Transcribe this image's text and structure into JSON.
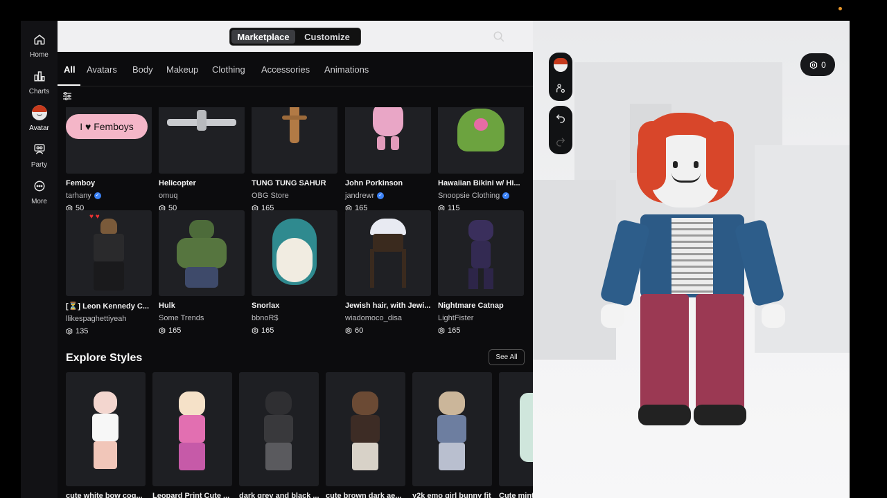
{
  "nav": {
    "items": [
      {
        "label": "Home",
        "icon": "home-icon"
      },
      {
        "label": "Charts",
        "icon": "charts-icon"
      },
      {
        "label": "Avatar",
        "icon": "avatar-icon"
      },
      {
        "label": "Party",
        "icon": "party-icon"
      },
      {
        "label": "More",
        "icon": "more-icon"
      }
    ]
  },
  "header": {
    "segment": {
      "marketplace": "Marketplace",
      "customize": "Customize",
      "active": "Marketplace"
    }
  },
  "tabs": [
    "All",
    "Avatars",
    "Body",
    "Makeup",
    "Clothing",
    "Accessories",
    "Animations"
  ],
  "active_tab": "All",
  "items_row1": [
    {
      "name": "Femboy",
      "creator": "tarhany",
      "verified": true,
      "price": "50",
      "badge_text": "I ♥ Femboys"
    },
    {
      "name": "Helicopter",
      "creator": "omuq",
      "verified": false,
      "price": "50"
    },
    {
      "name": "TUNG TUNG  SAHUR",
      "creator": "OBG Store",
      "verified": false,
      "price": "165"
    },
    {
      "name": "John Porkinson",
      "creator": "jandrewr",
      "verified": true,
      "price": "165"
    },
    {
      "name": "Hawaiian Bikini w/ Hi...",
      "creator": "Snoopsie Clothing",
      "verified": true,
      "price": "115"
    }
  ],
  "items_row2": [
    {
      "name": "[⏳] Leon Kennedy C...",
      "creator": "llikespaghettiyeah",
      "verified": false,
      "price": "135"
    },
    {
      "name": "Hulk",
      "creator": "Some Trends",
      "verified": false,
      "price": "165"
    },
    {
      "name": "Snorlax",
      "creator": "bbnoR$",
      "verified": false,
      "price": "165"
    },
    {
      "name": "Jewish hair, with Jewi...",
      "creator": "wiadomoco_disa",
      "verified": false,
      "price": "60"
    },
    {
      "name": "Nightmare Catnap",
      "creator": "LightFister",
      "verified": false,
      "price": "165"
    }
  ],
  "explore": {
    "title": "Explore Styles",
    "see_all": "See All",
    "styles": [
      {
        "name": "cute white bow cog..."
      },
      {
        "name": "Leopard Print Cute ..."
      },
      {
        "name": "dark grey and black ..."
      },
      {
        "name": "cute brown dark ae..."
      },
      {
        "name": "y2k emo girl bunny fit"
      },
      {
        "name": "Cute mint..."
      }
    ]
  },
  "viewport": {
    "robux_balance": "0"
  },
  "colors": {
    "accent_verified": "#3b82f6",
    "panel_bg": "#0c0c0e",
    "nav_bg": "#121215",
    "viewport_bg": "#eeeff0"
  }
}
